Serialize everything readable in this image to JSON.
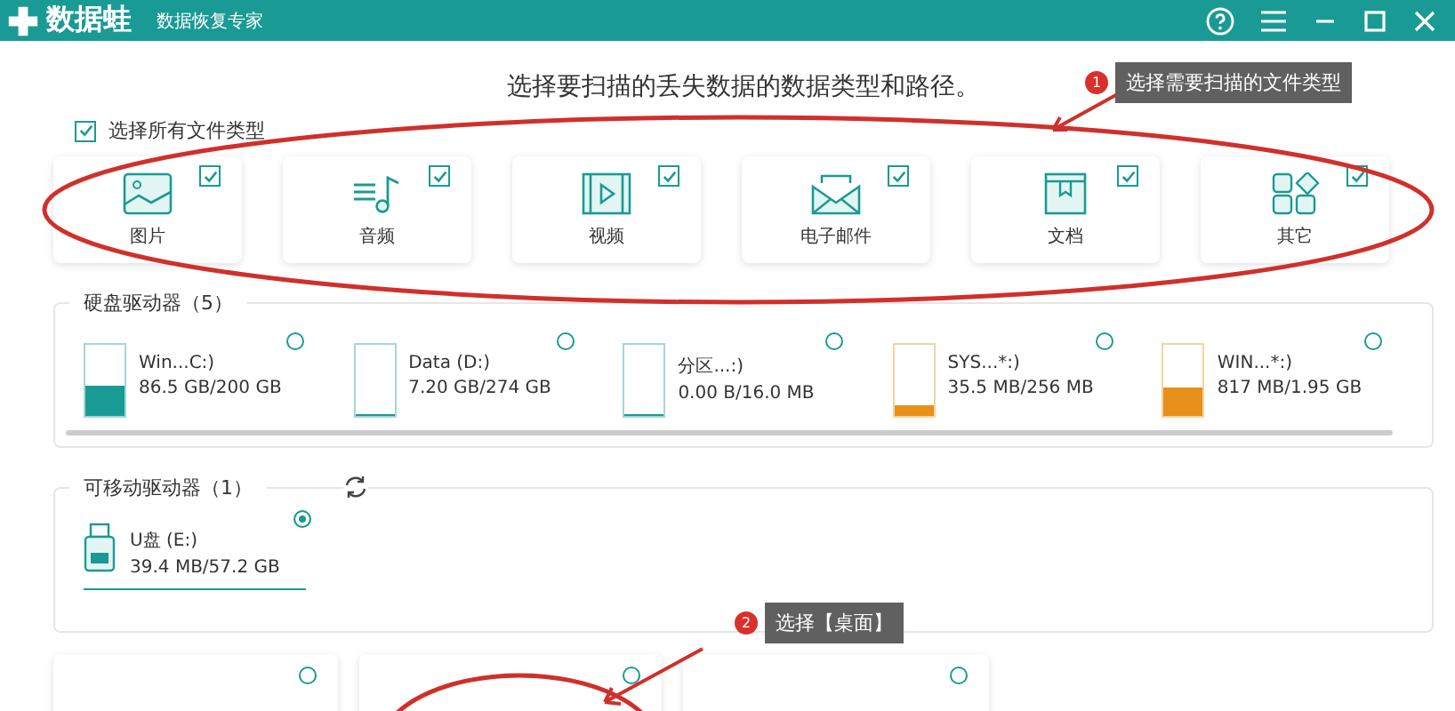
{
  "window": {
    "app_name": "数据蛙",
    "subtitle": "数据恢复专家"
  },
  "heading": "选择要扫描的丢失数据的数据类型和路径。",
  "select_all": {
    "label": "选择所有文件类型",
    "checked": true
  },
  "file_types": [
    {
      "kind": "image",
      "label": "图片",
      "checked": true
    },
    {
      "kind": "audio",
      "label": "音频",
      "checked": true
    },
    {
      "kind": "video",
      "label": "视频",
      "checked": true
    },
    {
      "kind": "email",
      "label": "电子邮件",
      "checked": true
    },
    {
      "kind": "document",
      "label": "文档",
      "checked": true
    },
    {
      "kind": "other",
      "label": "其它",
      "checked": true
    }
  ],
  "hard_drives": {
    "title": "硬盘驱动器（5）",
    "items": [
      {
        "name": "Win...C:)",
        "size": "86.5 GB/200 GB",
        "level": 0.43,
        "color": "#1a9a94",
        "selected": false
      },
      {
        "name": "Data (D:)",
        "size": "7.20 GB/274 GB",
        "level": 0.03,
        "color": "#1a9a94",
        "selected": false
      },
      {
        "name": "分区...:)",
        "size": "0.00  B/16.0 MB",
        "level": 0,
        "color": "#1a9a94",
        "selected": false
      },
      {
        "name": "SYS...*:)",
        "size": "35.5 MB/256 MB",
        "level": 0.14,
        "color": "#e8901a",
        "selected": false
      },
      {
        "name": "WIN...*:)",
        "size": "817 MB/1.95 GB",
        "level": 0.41,
        "color": "#e8901a",
        "selected": false
      }
    ]
  },
  "removable_drives": {
    "title": "可移动驱动器（1）",
    "items": [
      {
        "name": "U盘 (E:)",
        "size": "39.4 MB/57.2 GB",
        "selected": true
      }
    ]
  },
  "locations": [
    {
      "selected": false
    },
    {
      "selected": false
    },
    {
      "selected": false
    }
  ],
  "callouts": [
    {
      "number": "1",
      "text": "选择需要扫描的文件类型"
    },
    {
      "number": "2",
      "text": "选择【桌面】"
    }
  ]
}
